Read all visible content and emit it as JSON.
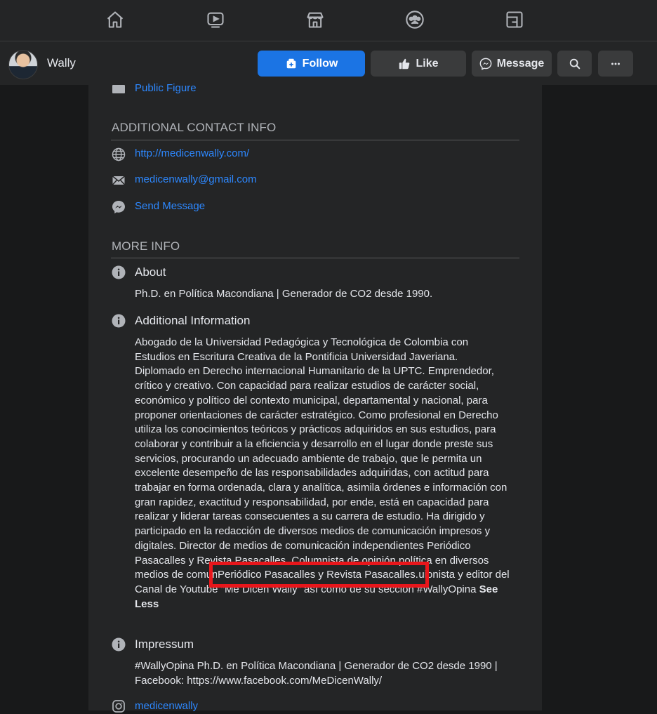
{
  "page": {
    "name": "Wally",
    "category": "Public Figure"
  },
  "buttons": {
    "follow": "Follow",
    "like": "Like",
    "message": "Message"
  },
  "contact": {
    "section_title": "ADDITIONAL CONTACT INFO",
    "website": "http://medicenwally.com/",
    "email": "medicenwally@gmail.com",
    "send_message": "Send Message"
  },
  "more_info": {
    "section_title": "MORE INFO",
    "about_label": "About",
    "about_text": "Ph.D. en Política Macondiana | Generador de CO2 desde 1990.",
    "additional_label": "Additional Information",
    "additional_text": "Abogado de la Universidad Pedagógica y Tecnológica de Colombia con Estudios en Escritura Creativa de la Pontificia Universidad Javeriana. Diplomado en Derecho internacional Humanitario de la UPTC. Emprendedor, crítico y creativo. Con capacidad para realizar estudios de carácter social, económico y político del contexto municipal, departamental y nacional, para proponer orientaciones de carácter estratégico. Como profesional en Derecho utiliza los conocimientos teóricos y prácticos adquiridos en sus estudios, para colaborar y contribuir a la eficiencia y desarrollo en el lugar donde preste sus servicios, procurando un adecuado ambiente de trabajo, que le permita un excelente desempeño de las responsabilidades adquiridas, con actitud para trabajar en forma ordenada, clara y analítica, asimila órdenes e información con gran rapidez, exactitud y responsabilidad, por ende, está en capacidad para realizar y liderar tareas consecuentes a su carrera de estudio. Ha dirigido y participado en la redacción de diversos medios de comunicación impresos y digitales. Director de medios de comunicación independientes Periódico Pasacalles y Revista Pasacalles. Columnista de opinión política en diversos medios de comunicación nacionales. Actualmente Director, guionista y editor del Canal de Youtube \"Me Dicen Wally\" así como de su sección #WallyOpina",
    "see_less": "See Less",
    "highlighted_text": "Periódico Pasacalles y Revista Pasacalles.",
    "impressum_label": "Impressum",
    "impressum_text": "#WallyOpina Ph.D. en Política Macondiana | Generador de CO2 desde 1990 | Facebook: https://www.facebook.com/MeDicenWally/",
    "instagram": "medicenwally"
  },
  "colors": {
    "accent": "#1b74e4",
    "link": "#2d88ff",
    "highlight": "#e8161b",
    "background": "#18191a",
    "card": "#242526"
  },
  "icons": [
    "home-icon",
    "watch-icon",
    "marketplace-icon",
    "groups-icon",
    "gaming-icon",
    "search-icon",
    "more-icon",
    "globe-icon",
    "mail-icon",
    "messenger-icon",
    "info-icon",
    "instagram-icon",
    "category-icon"
  ]
}
